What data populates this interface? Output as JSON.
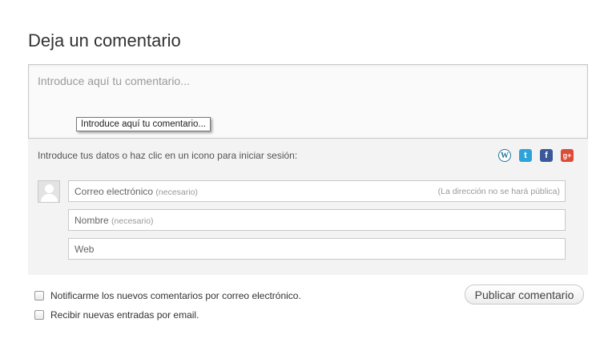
{
  "heading": "Deja un comentario",
  "comment": {
    "placeholder": "Introduce aquí tu comentario...",
    "tooltip": "Introduce aquí tu comentario..."
  },
  "identity": {
    "intro": "Introduce tus datos o haz clic en un icono para iniciar sesión:",
    "social_icons": [
      {
        "name": "wordpress-icon",
        "glyph": "W",
        "color": "#21759b"
      },
      {
        "name": "twitter-icon",
        "glyph": "t",
        "color": "#2ea3d8"
      },
      {
        "name": "facebook-icon",
        "glyph": "f",
        "color": "#3b5998"
      },
      {
        "name": "google-plus-icon",
        "glyph": "g+",
        "color": "#dd4b39"
      }
    ],
    "email": {
      "label": "Correo electrónico",
      "required": "(necesario)",
      "note": "(La dirección no se hará pública)"
    },
    "name": {
      "label": "Nombre",
      "required": "(necesario)"
    },
    "web": {
      "label": "Web"
    }
  },
  "submit_label": "Publicar comentario",
  "options": {
    "notify_comments": "Notificarme los nuevos comentarios por correo electrónico.",
    "notify_posts": "Recibir nuevas entradas por email."
  }
}
